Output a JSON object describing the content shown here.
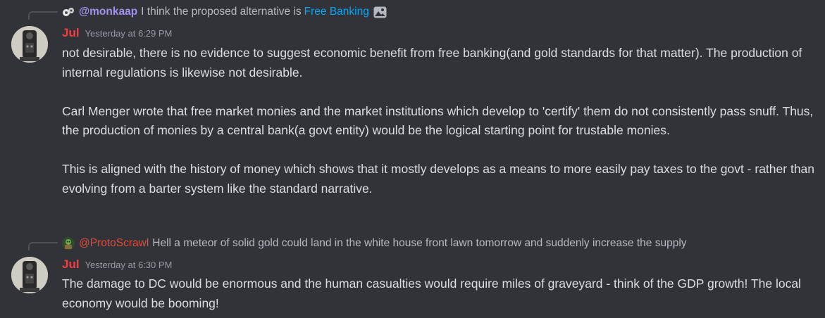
{
  "messages": [
    {
      "reply": {
        "author": "@monkaap",
        "author_color": "#a191f0",
        "text": "I think the proposed alternative is",
        "link": "Free Banking",
        "attachment_icon": "image-icon"
      },
      "author": "Jul",
      "author_color": "#f23f42",
      "timestamp": "Yesterday at 6:29 PM",
      "paragraphs": [
        "not desirable, there is no evidence to suggest economic benefit from free banking(and gold standards for that matter). The production of internal regulations is likewise not desirable.",
        "Carl Menger wrote that free market monies and the market institutions which develop to 'certify' them do not consistently pass snuff. Thus, the production of monies by a central bank(a govt entity) would be the logical starting point for trustable monies.",
        "This is aligned with the history of money which shows that it mostly develops as a means to more easily pay taxes to the govt - rather than evolving from a barter system like the standard narrative."
      ]
    },
    {
      "reply": {
        "author": "@ProtoScrawl",
        "author_color": "#e24b3b",
        "text": "Hell a meteor of solid gold could land in the white house front lawn tomorrow and suddenly increase the supply"
      },
      "author": "Jul",
      "author_color": "#f23f42",
      "timestamp": "Yesterday at 6:30 PM",
      "paragraphs": [
        "The damage to DC would be enormous and the human casualties would require miles of graveyard - think of the GDP growth! The local economy would be booming!"
      ]
    }
  ]
}
